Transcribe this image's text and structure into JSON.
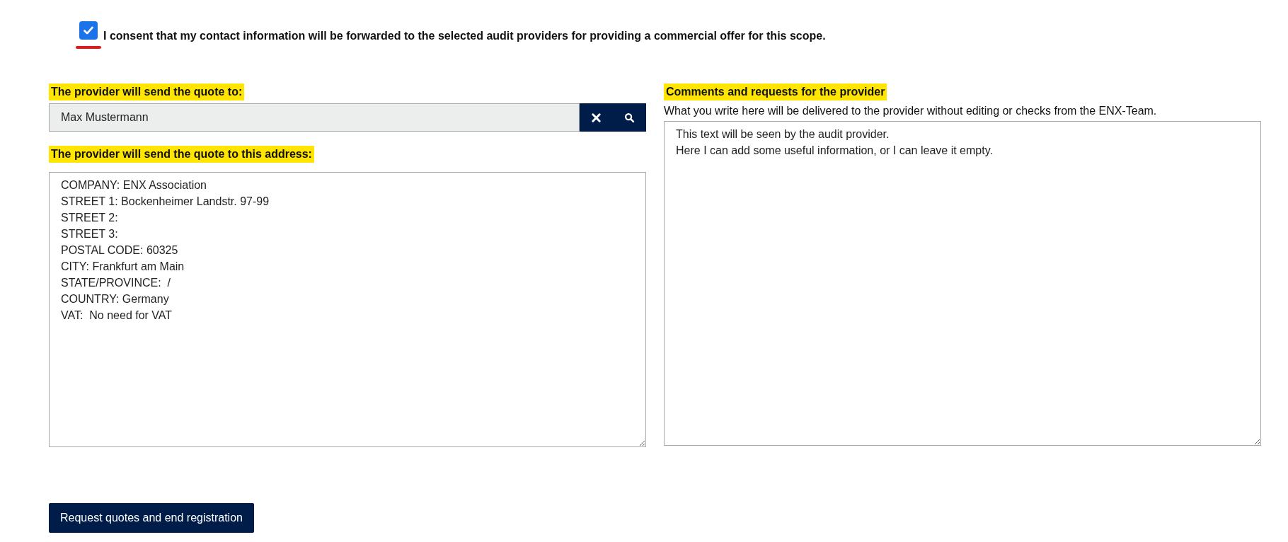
{
  "consent": {
    "checked": true,
    "text": "I consent that my contact information will be forwarded to the selected audit providers for providing a commercial offer for this scope."
  },
  "recipient": {
    "label": "The provider will send the quote to:",
    "value": "Max Mustermann"
  },
  "address": {
    "label": "The provider will send the quote to this address:",
    "lines": [
      "COMPANY: ENX Association",
      "STREET 1: Bockenheimer Landstr. 97-99",
      "STREET 2: ",
      "STREET 3: ",
      "POSTAL CODE: 60325",
      "CITY: Frankfurt am Main",
      "STATE/PROVINCE:  /",
      "COUNTRY: Germany",
      "VAT:  No need for VAT"
    ]
  },
  "comments": {
    "label": "Comments and requests for the provider",
    "hint": "What you write here will be delivered to the provider without editing or checks from the ENX-Team.",
    "lines": [
      "This text will be seen by the audit provider.",
      "Here I can add some useful information, or I can leave it empty."
    ]
  },
  "submit": {
    "label": "Request quotes and end registration"
  }
}
